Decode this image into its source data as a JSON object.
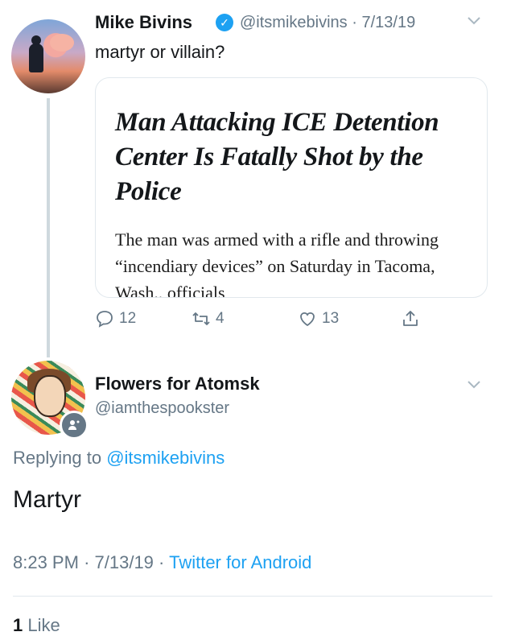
{
  "parent_tweet": {
    "name": "Mike Bivins",
    "handle": "@itsmikebivins",
    "separator": "·",
    "date": "7/13/19",
    "text": "martyr or villain?",
    "card": {
      "headline": "Man Attacking ICE Detention Center Is Fatally Shot by the Police",
      "summary": "The man was armed with a rifle and throwing “incendiary devices” on Saturday in Tacoma, Wash., officials"
    },
    "actions": {
      "replies": "12",
      "retweets": "4",
      "likes": "13"
    }
  },
  "reply_tweet": {
    "name": "Flowers for Atomsk",
    "handle": "@iamthespookster",
    "replying_prefix": "Replying to",
    "replying_to": "@itsmikebivins",
    "text": "Martyr",
    "time": "8:23 PM",
    "separator": "·",
    "date": "7/13/19",
    "source": "Twitter for Android",
    "like_count": "1",
    "like_label": "Like"
  },
  "icons": [
    "verified-badge-icon",
    "chevron-down-icon",
    "reply-icon",
    "retweet-icon",
    "heart-icon",
    "share-icon",
    "account-badge-icon"
  ],
  "colors": {
    "link": "#1da1f2",
    "secondary_text": "#657786",
    "primary_text": "#14171a"
  }
}
